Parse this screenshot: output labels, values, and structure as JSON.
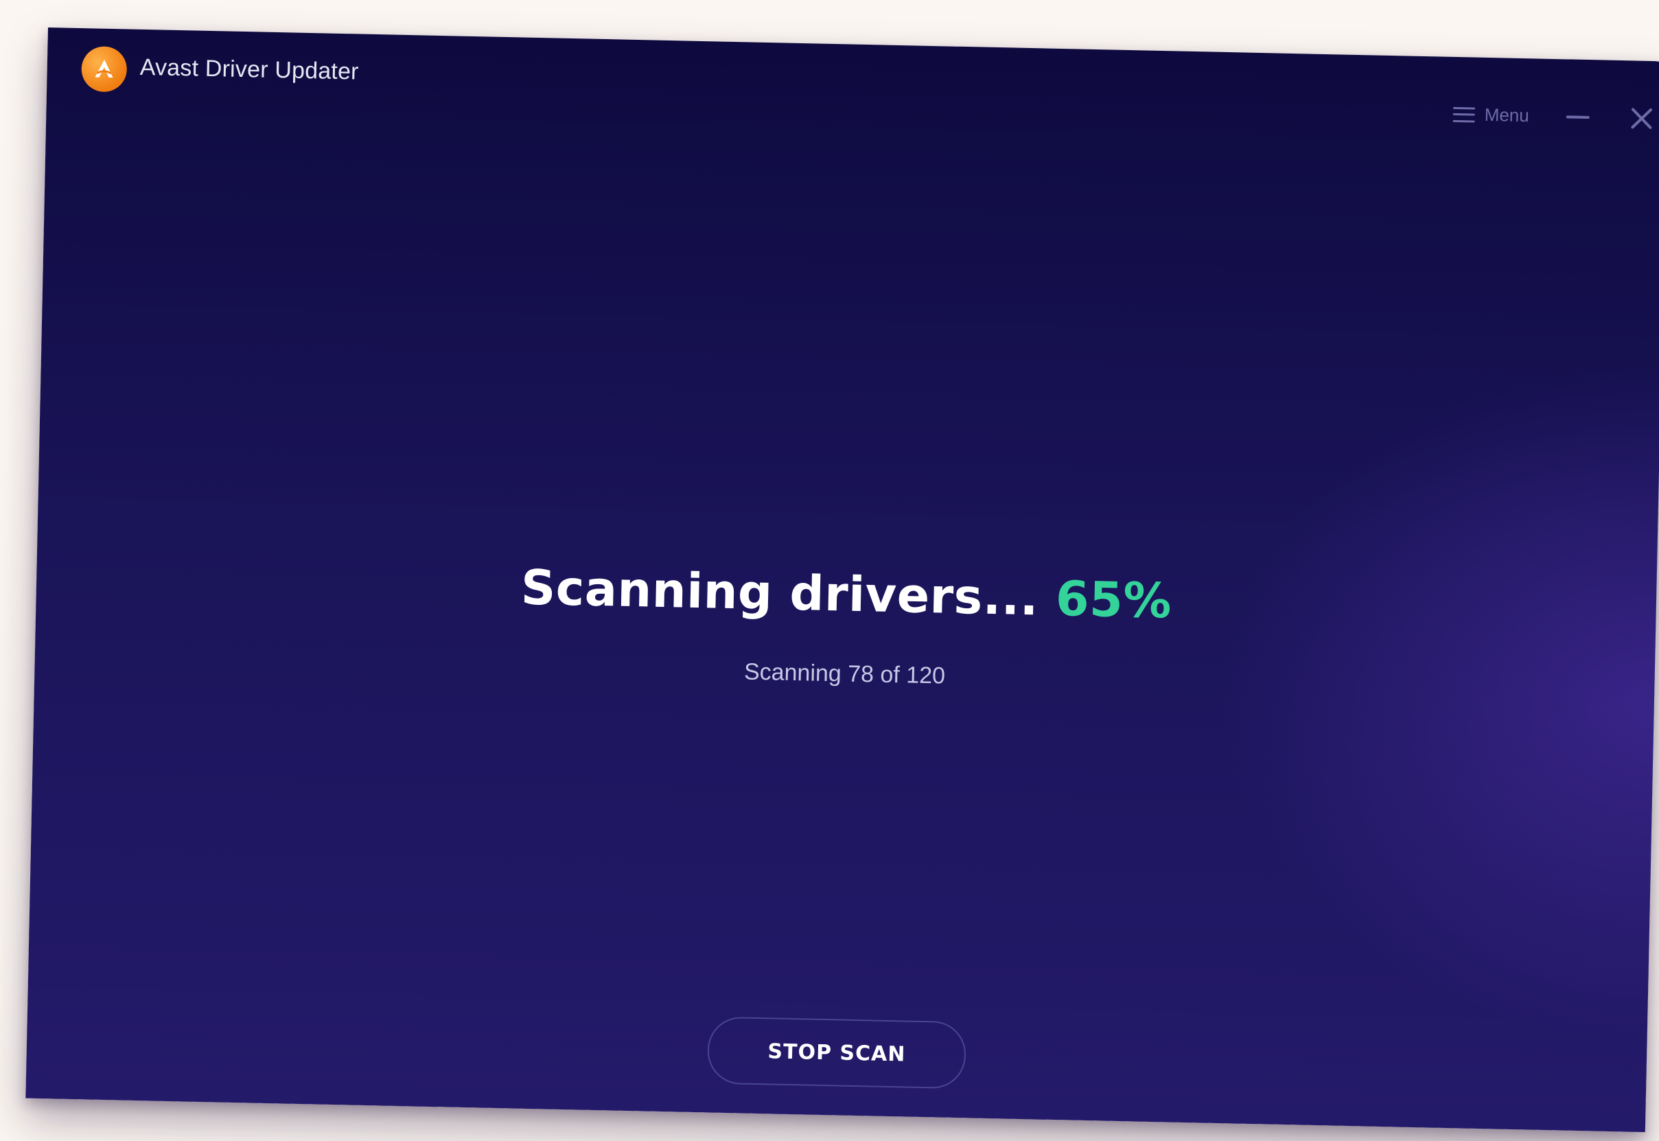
{
  "window": {
    "title": "Avast Driver Updater",
    "accent_color": "#f07d10",
    "background_color": "#1a1458"
  },
  "header": {
    "menu_label": "Menu",
    "menu_icon": "hamburger-icon",
    "minimize_icon": "minimize-icon",
    "close_icon": "close-icon"
  },
  "scan": {
    "heading": "Scanning drivers...",
    "percent_text": "65%",
    "progress_percent": 65,
    "status_text": "Scanning 78 of 120",
    "percent_color": "#34d399"
  },
  "actions": {
    "stop_label": "STOP SCAN"
  }
}
